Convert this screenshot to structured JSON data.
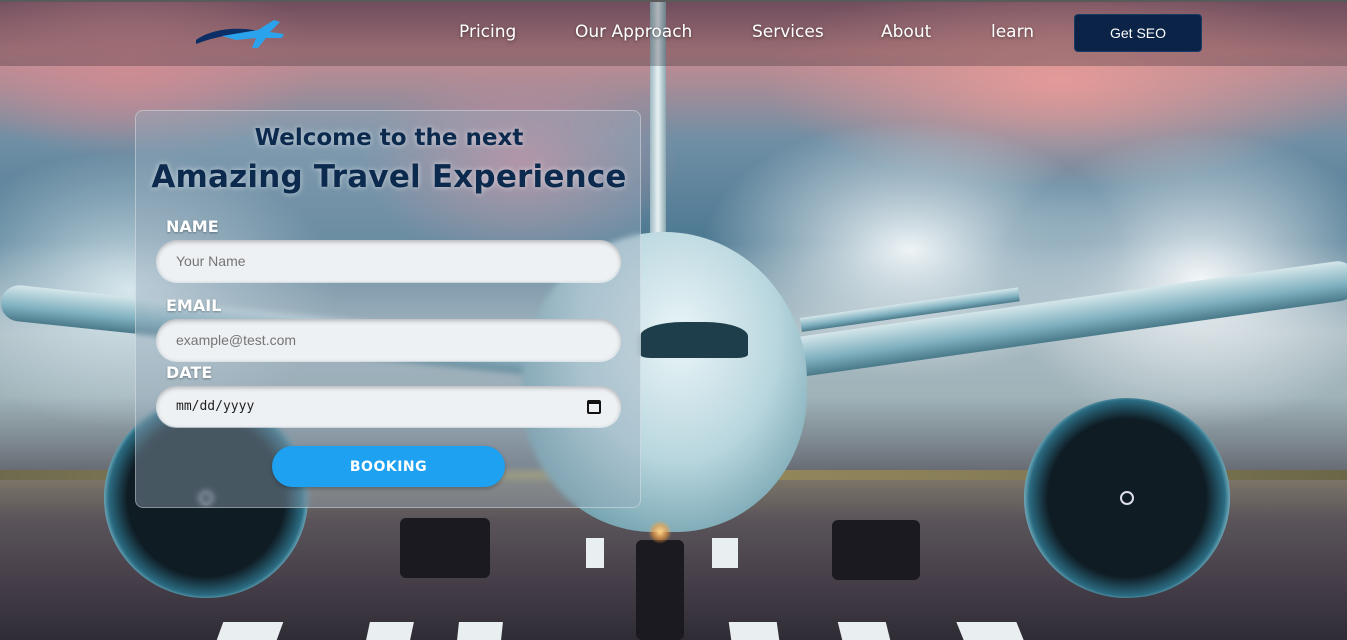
{
  "brand": {
    "logo_icon": "airplane-icon"
  },
  "nav": {
    "links": [
      "Pricing",
      "Our Approach",
      "Services",
      "About",
      "learn"
    ],
    "cta_label": "Get SEO"
  },
  "form": {
    "kicker": "Welcome to the next",
    "title": "Amazing Travel Experience",
    "name_label": "NAME",
    "name_placeholder": "Your Name",
    "email_label": "EMAIL",
    "email_placeholder": "example@test.com",
    "date_label": "DATE",
    "date_value": "mm/dd/yyyy",
    "date_icon": "calendar-icon",
    "submit_label": "BOOKING"
  },
  "colors": {
    "brand_navy": "#0b2346",
    "title_navy": "#0c2a4e",
    "button_blue": "#1ea1f0"
  }
}
